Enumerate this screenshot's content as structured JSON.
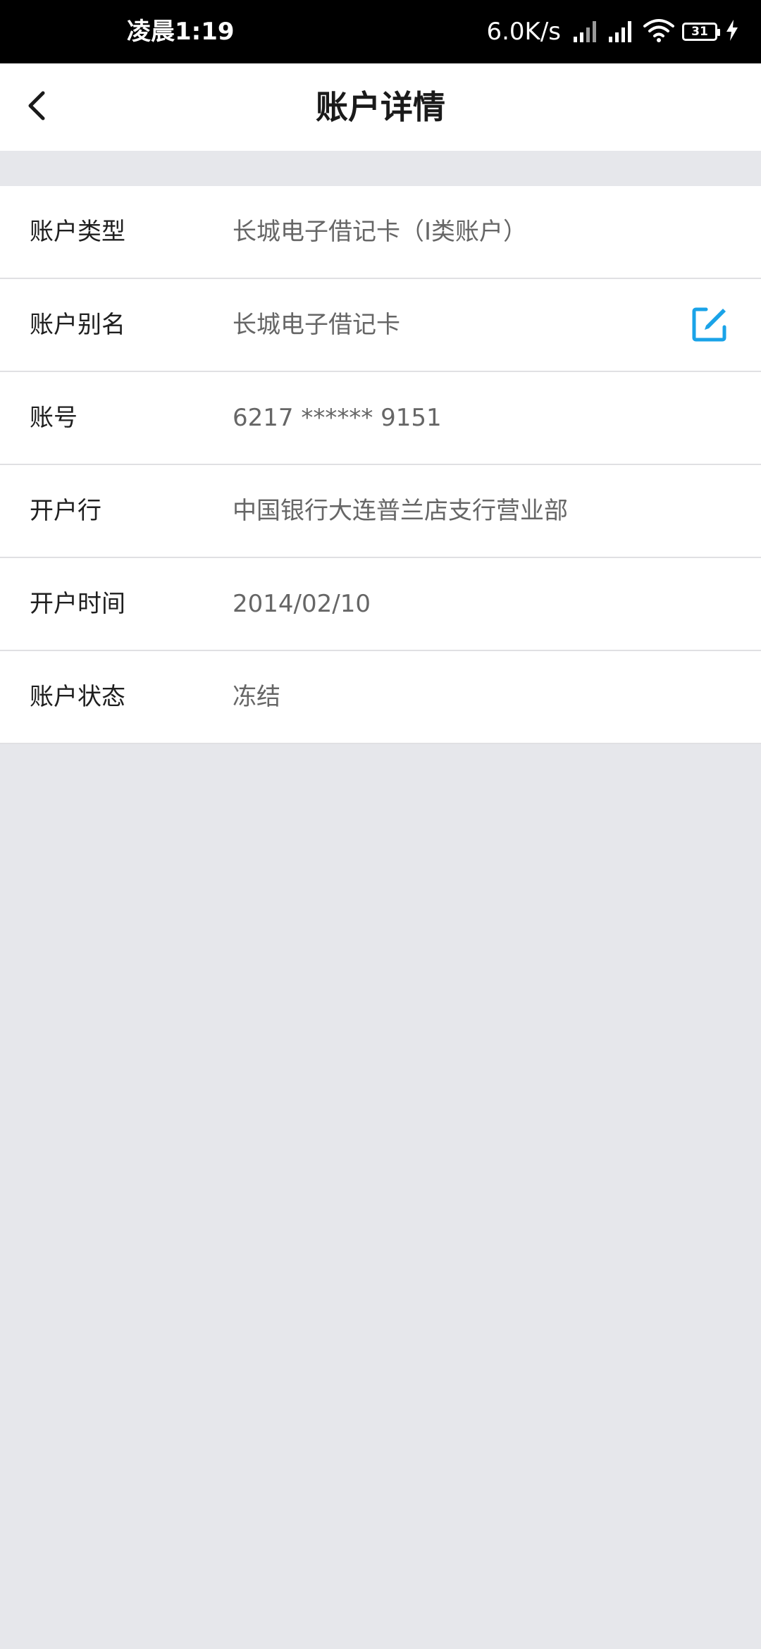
{
  "status_bar": {
    "time": "凌晨1:19",
    "net_speed": "6.0K/s",
    "battery_level": "31",
    "icons": [
      "signal-icon",
      "signal-icon",
      "wifi-icon",
      "battery-icon",
      "charging-icon"
    ]
  },
  "header": {
    "title": "账户详情",
    "back_icon": "chevron-left-icon"
  },
  "details": [
    {
      "label": "账户类型",
      "value": "长城电子借记卡（I类账户）"
    },
    {
      "label": "账户别名",
      "value": "长城电子借记卡",
      "action_icon": "edit-icon"
    },
    {
      "label": "账号",
      "value": "6217 ****** 9151"
    },
    {
      "label": "开户行",
      "value": "中国银行大连普兰店支行营业部"
    },
    {
      "label": "开户时间",
      "value": "2014/02/10"
    },
    {
      "label": "账户状态",
      "value": "冻结"
    }
  ],
  "colors": {
    "status_bar_bg": "#000000",
    "page_bg": "#e6e7eb",
    "accent": "#1aa3e8",
    "value_text": "#666666"
  }
}
